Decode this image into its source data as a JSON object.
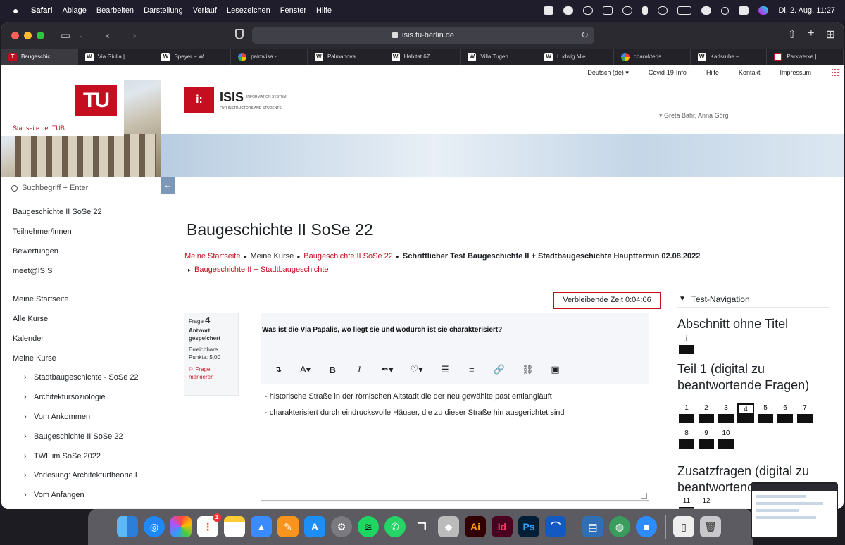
{
  "menubar": {
    "app": "Safari",
    "items": [
      "Ablage",
      "Bearbeiten",
      "Darstellung",
      "Verlauf",
      "Lesezeichen",
      "Fenster",
      "Hilfe"
    ],
    "clock": "Di. 2. Aug.  11:27"
  },
  "browser": {
    "url": "isis.tu-berlin.de",
    "tabs": [
      {
        "favicon": "tu",
        "label": "Baugeschic..."
      },
      {
        "favicon": "W",
        "label": "Via Giulia |..."
      },
      {
        "favicon": "W",
        "label": "Speyer – W..."
      },
      {
        "favicon": "g",
        "label": "palmvisa -..."
      },
      {
        "favicon": "W",
        "label": "Palmanova..."
      },
      {
        "favicon": "W",
        "label": "Habitat 67..."
      },
      {
        "favicon": "W",
        "label": "Villa Tugen..."
      },
      {
        "favicon": "W",
        "label": "Ludwig Mie..."
      },
      {
        "favicon": "g",
        "label": "charakteris..."
      },
      {
        "favicon": "W",
        "label": "Karlsruhe –..."
      },
      {
        "favicon": "p",
        "label": "Parkwerke |..."
      }
    ]
  },
  "site": {
    "topnav": [
      "Deutsch (de) ▾",
      "Covid-19-Info",
      "Hilfe",
      "Kontakt",
      "Impressum"
    ],
    "tu_caption": "Startseite der TUB",
    "tu_logo": "TU",
    "isis_mark": "i:",
    "isis_name": "ISIS",
    "isis_sub": "INFORMATION SYSTEM",
    "isis_subtitle": "FÜR INSTRUCTORS AND STUDENTS",
    "user": "▾ Greta Bahr, Anna Görg"
  },
  "sidebar": {
    "search_placeholder": "Suchbegriff + Enter",
    "items": [
      "Baugeschichte II SoSe 22",
      "Teilnehmer/innen",
      "Bewertungen",
      "meet@ISIS",
      "Meine Startseite",
      "Alle Kurse",
      "Kalender",
      "Meine Kurse"
    ],
    "courses": [
      "Stadtbaugeschichte - SoSe 22",
      "Architektursoziologie",
      "Vom Ankommen",
      "Baugeschichte II SoSe 22",
      "TWL im SoSe 2022",
      "Vorlesung: Architekturtheorie I",
      "Vom Anfangen"
    ]
  },
  "main": {
    "title": "Baugeschichte II SoSe 22",
    "breadcrumb": {
      "home": "Meine Startseite",
      "courses": "Meine Kurse",
      "course": "Baugeschichte II SoSe 22",
      "test": "Schriftlicher Test Baugeschichte II + Stadtbaugeschichte Haupttermin 02.08.2022",
      "section": "Baugeschichte II + Stadtbaugeschichte"
    },
    "timer": "Verbleibende Zeit 0:04:06",
    "question": {
      "label": "Frage",
      "number": "4",
      "status_1": "Antwort",
      "status_2": "gespeichert",
      "points_1": "Erreichbare",
      "points_2": "Punkte: 5,00",
      "flag_1": "Frage",
      "flag_2": "markieren",
      "text": "Was ist die Via Papalis, wo liegt sie und wodurch ist sie charakterisiert?",
      "answer_lines": [
        "- historische Straße in der römischen Altstadt die der neu gewählte past entlangläuft",
        "- charakterisiert durch eindrucksvolle Häuser, die zu dieser Straße hin ausgerichtet sind"
      ]
    },
    "editor_toolbar": [
      "↴",
      "A▾",
      "B",
      "I",
      "✒▾",
      "♡▾",
      "☰",
      "≡",
      "🔗",
      "⛓",
      "▣"
    ]
  },
  "test_navigation": {
    "header": "Test-Navigation",
    "sections": [
      {
        "title": "Abschnitt ohne Titel",
        "buttons": [
          "i"
        ]
      },
      {
        "title": "Teil 1 (digital zu beantwortende Fragen)",
        "buttons": [
          "1",
          "2",
          "3",
          "4",
          "5",
          "6",
          "7",
          "8",
          "9",
          "10"
        ],
        "current": "4"
      },
      {
        "title": "Zusatzfragen (digital zu beantwortende Fragen)",
        "buttons": [
          "11",
          "12"
        ]
      }
    ]
  },
  "dock": {
    "apps": [
      "finder-icon",
      "safari-icon",
      "photos-icon",
      "reminders-icon",
      "notes-icon",
      "keynote-icon",
      "pages-icon",
      "app-store-icon",
      "system-preferences-icon",
      "spotify-icon",
      "whatsapp-icon",
      "vectorworks-icon",
      "archicad-icon",
      "illustrator-icon",
      "indesign-icon",
      "photoshop-icon",
      "arc-icon",
      "preview-icon",
      "network-icon",
      "zoom-icon",
      "document-icon",
      "trash-icon"
    ],
    "labels": {
      "ai": "Ai",
      "id": "Id",
      "ps": "Ps",
      "badge": "1"
    }
  }
}
